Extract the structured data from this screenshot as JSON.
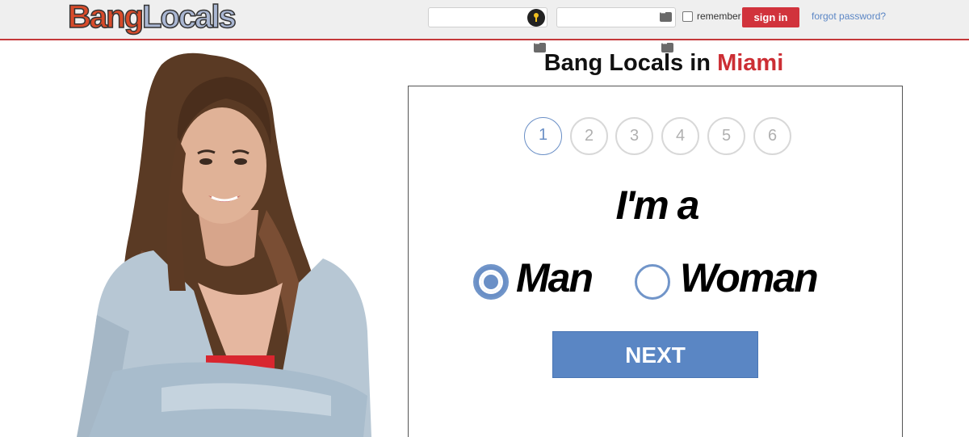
{
  "header": {
    "logo_part1": "Bang",
    "logo_part2": "Locals",
    "remember_label": "remember",
    "signin_label": "sign in",
    "forgot_label": "forgot password?"
  },
  "heading": {
    "prefix": "Bang Locals in ",
    "city": "Miami"
  },
  "form": {
    "steps": [
      "1",
      "2",
      "3",
      "4",
      "5",
      "6"
    ],
    "active_step": 1,
    "prompt": "I'm a",
    "options": [
      {
        "label": "Man",
        "selected": true
      },
      {
        "label": "Woman",
        "selected": false
      }
    ],
    "next_label": "NEXT"
  },
  "colors": {
    "accent_red": "#d1333c",
    "accent_blue": "#5a86c4",
    "link_blue": "#5b86c5"
  },
  "icons": {
    "username_field": "key-icon",
    "password_field": "dots-icon"
  }
}
